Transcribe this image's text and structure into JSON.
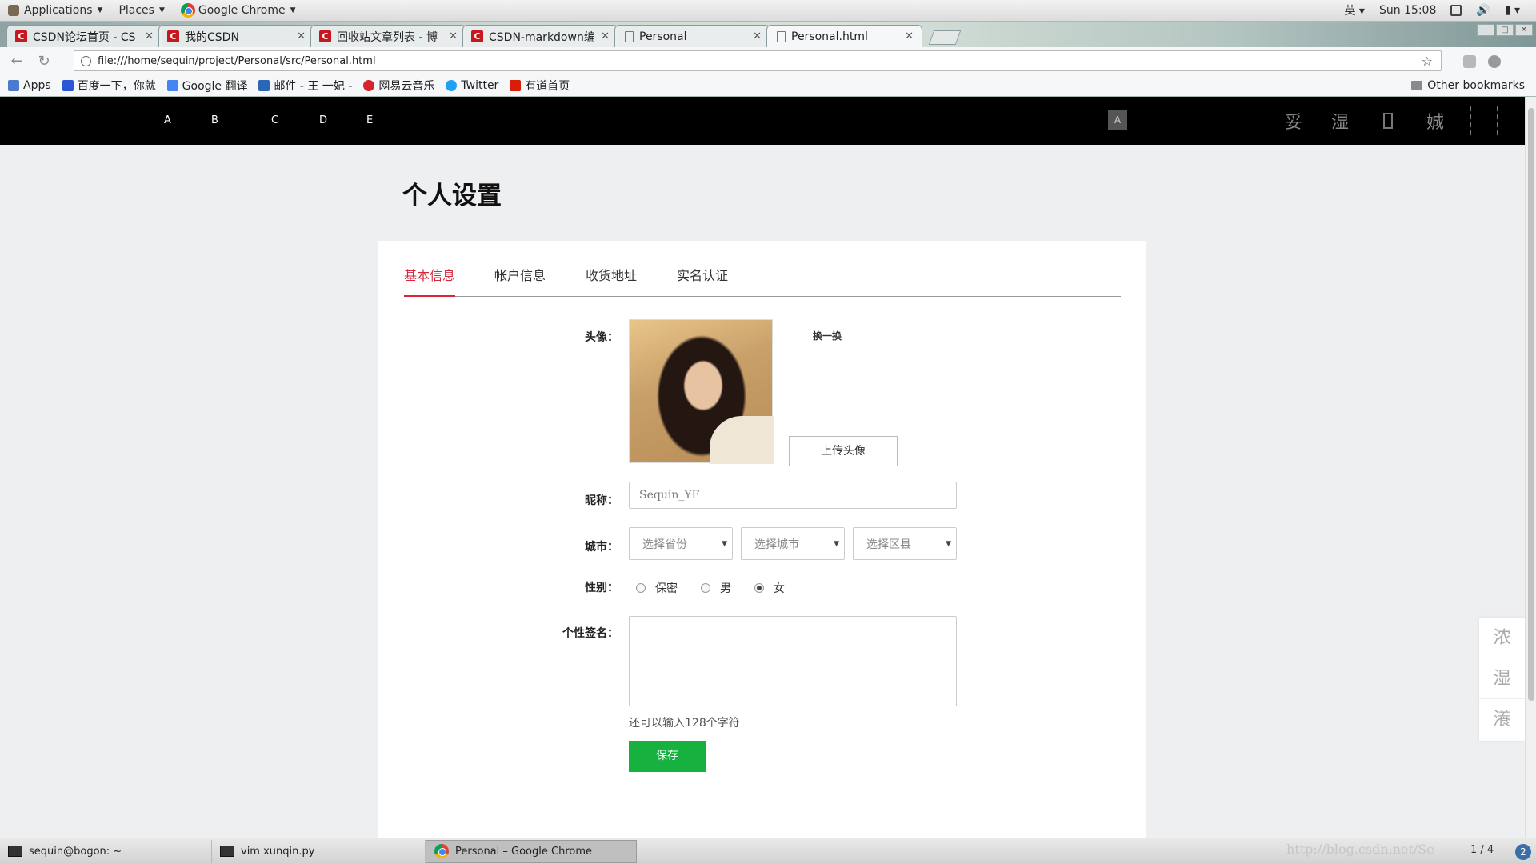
{
  "gnome": {
    "applications": "Applications",
    "places": "Places",
    "active_app": "Google Chrome",
    "input_method": "英",
    "clock": "Sun 15:08"
  },
  "browser": {
    "tabs": [
      {
        "title": "CSDN论坛首页 - CS",
        "icon": "csdn"
      },
      {
        "title": "我的CSDN",
        "icon": "csdn"
      },
      {
        "title": "回收站文章列表 - 博",
        "icon": "csdn"
      },
      {
        "title": "CSDN-markdown编",
        "icon": "csdn"
      },
      {
        "title": "Personal",
        "icon": "doc"
      },
      {
        "title": "Personal.html",
        "icon": "doc"
      }
    ],
    "url": "file:///home/sequin/project/Personal/src/Personal.html",
    "bookmarks": [
      {
        "label": "Apps",
        "color": "#4a7bd0"
      },
      {
        "label": "百度一下，你就",
        "color": "#2b55d6"
      },
      {
        "label": "Google 翻译",
        "color": "#4285f4"
      },
      {
        "label": "邮件 - 王 一妃 -",
        "color": "#2a67b7"
      },
      {
        "label": "网易云音乐",
        "color": "#d6232c"
      },
      {
        "label": "Twitter",
        "color": "#1da1f2"
      },
      {
        "label": "有道首页",
        "color": "#d81e06"
      }
    ],
    "other_bookmarks": "Other bookmarks"
  },
  "site_nav": {
    "links": [
      "A",
      "B",
      "C",
      "D",
      "E"
    ],
    "search_button": "A",
    "icons": [
      "妥",
      "湿",
      "",
      "娍",
      ""
    ]
  },
  "page": {
    "title": "个人设置",
    "tabs": [
      "基本信息",
      "帐户信息",
      "收货地址",
      "实名认证"
    ],
    "form": {
      "avatar_label": "头像：",
      "swap_label": "换一换",
      "upload_label": "上传头像",
      "nickname_label": "昵称：",
      "nickname_value": "Sequin_YF",
      "city_label": "城市：",
      "province_placeholder": "选择省份",
      "city_placeholder": "选择城市",
      "district_placeholder": "选择区县",
      "gender_label": "性别：",
      "gender_options": [
        "保密",
        "男",
        "女"
      ],
      "gender_selected": "女",
      "signature_label": "个性签名：",
      "hint": "还可以输入128个字符",
      "save_label": "保存"
    },
    "float_bar": [
      "浓",
      "湿",
      "瀁"
    ]
  },
  "taskbar": {
    "tasks": [
      "sequin@bogon: ~",
      "vim xunqin.py",
      "Personal – Google Chrome"
    ],
    "watermark": "http://blog.csdn.net/Se",
    "pager": "1 / 4",
    "badge": "2"
  }
}
